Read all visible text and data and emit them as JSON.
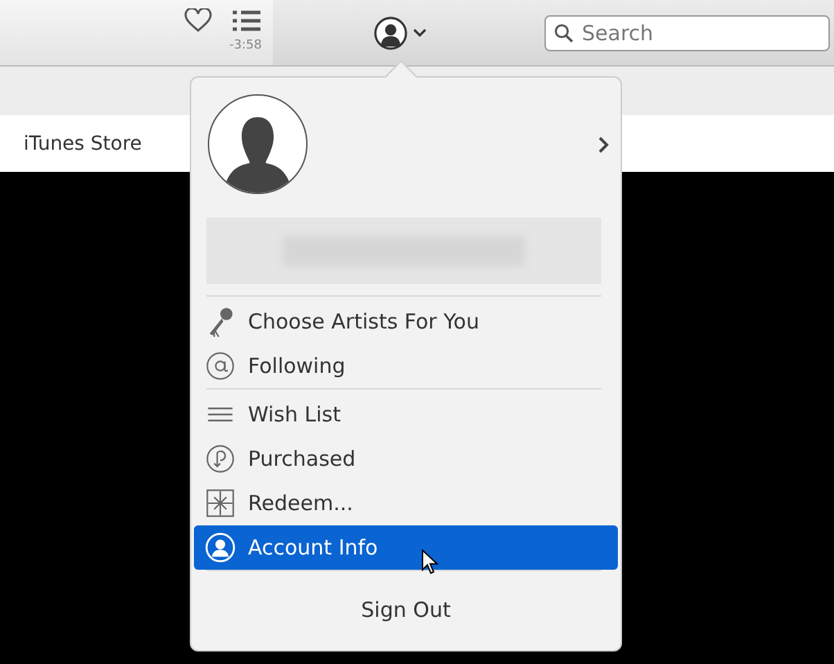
{
  "toolbar": {
    "time_remaining": "-3:58",
    "search": {
      "placeholder": "Search"
    }
  },
  "nav": {
    "title": "iTunes Store"
  },
  "account_menu": {
    "sections": [
      {
        "items": [
          {
            "label": "Choose Artists For You",
            "selected": false
          },
          {
            "label": "Following",
            "selected": false
          }
        ]
      },
      {
        "items": [
          {
            "label": "Wish List",
            "selected": false
          },
          {
            "label": "Purchased",
            "selected": false
          },
          {
            "label": "Redeem...",
            "selected": false
          },
          {
            "label": "Account Info",
            "selected": true
          }
        ]
      }
    ],
    "sign_out": "Sign Out"
  }
}
